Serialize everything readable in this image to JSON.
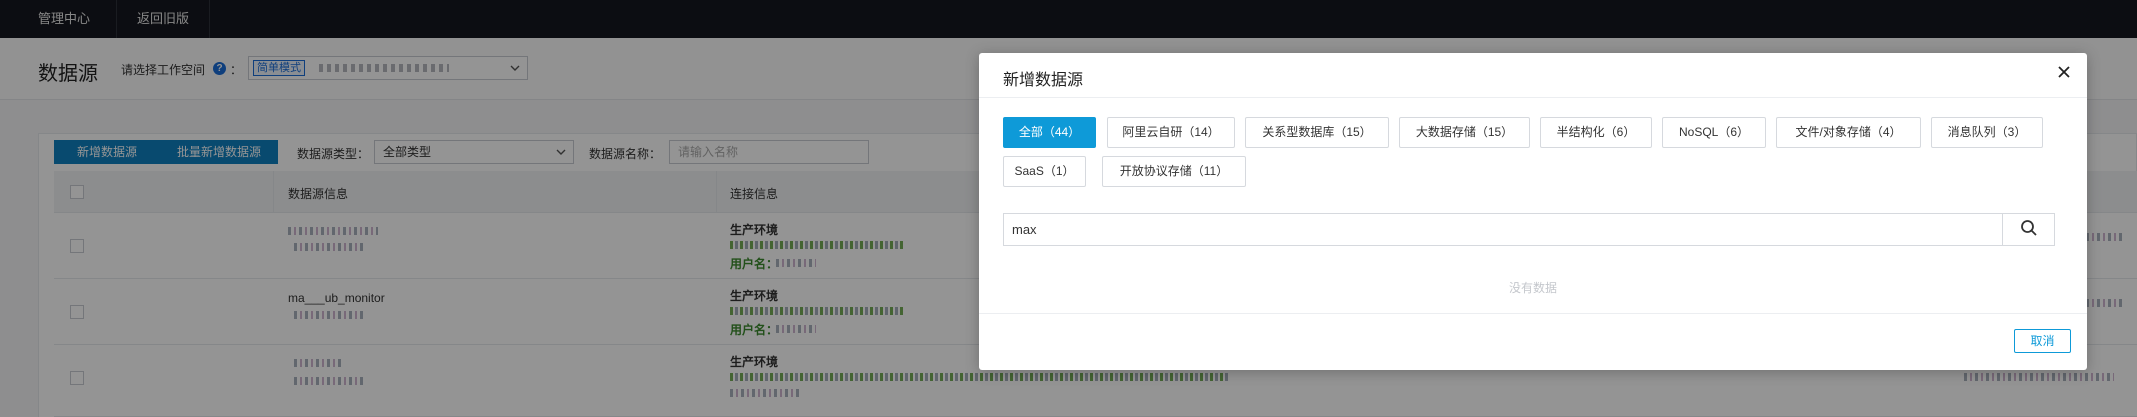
{
  "topnav": {
    "items": [
      {
        "label": "管理中心"
      },
      {
        "label": "返回旧版"
      }
    ]
  },
  "header": {
    "title": "数据源",
    "workspace_label": "请选择工作空间",
    "workspace_colon": "：",
    "help_icon": "question-icon",
    "workspace_tag": "简单模式"
  },
  "toolbar": {
    "add_label": "新增数据源",
    "batch_add_label": "批量新增数据源",
    "type_label": "数据源类型：",
    "type_value": "全部类型",
    "name_label": "数据源名称：",
    "name_placeholder": "请输入名称"
  },
  "table": {
    "columns": [
      "数据源信息",
      "连接信息"
    ],
    "rows": [
      {
        "env": "生产环境",
        "user_label": "用户名："
      },
      {
        "name": "ma___ub_monitor",
        "env": "生产环境",
        "user_label": "用户名："
      },
      {
        "env": "生产环境",
        "user_label": ""
      }
    ]
  },
  "modal": {
    "title": "新增数据源",
    "close_icon": "close-icon",
    "categories": [
      {
        "label": "全部（44）",
        "active": true
      },
      {
        "label": "阿里云自研（14）",
        "active": false
      },
      {
        "label": "关系型数据库（15）",
        "active": false
      },
      {
        "label": "大数据存储（15）",
        "active": false
      },
      {
        "label": "半结构化（6）",
        "active": false
      },
      {
        "label": "NoSQL（6）",
        "active": false
      },
      {
        "label": "文件/对象存储（4）",
        "active": false
      },
      {
        "label": "消息队列（3）",
        "active": false
      },
      {
        "label": "SaaS（1）",
        "active": false
      },
      {
        "label": "开放协议存储（11）",
        "active": false
      }
    ],
    "search_value": "max",
    "search_icon": "search-icon",
    "empty_text": "没有数据",
    "cancel_label": "取消"
  },
  "colors": {
    "accent": "#0e9ad8",
    "primary_button": "#0e80c0",
    "topnav_bg": "#16181f"
  }
}
